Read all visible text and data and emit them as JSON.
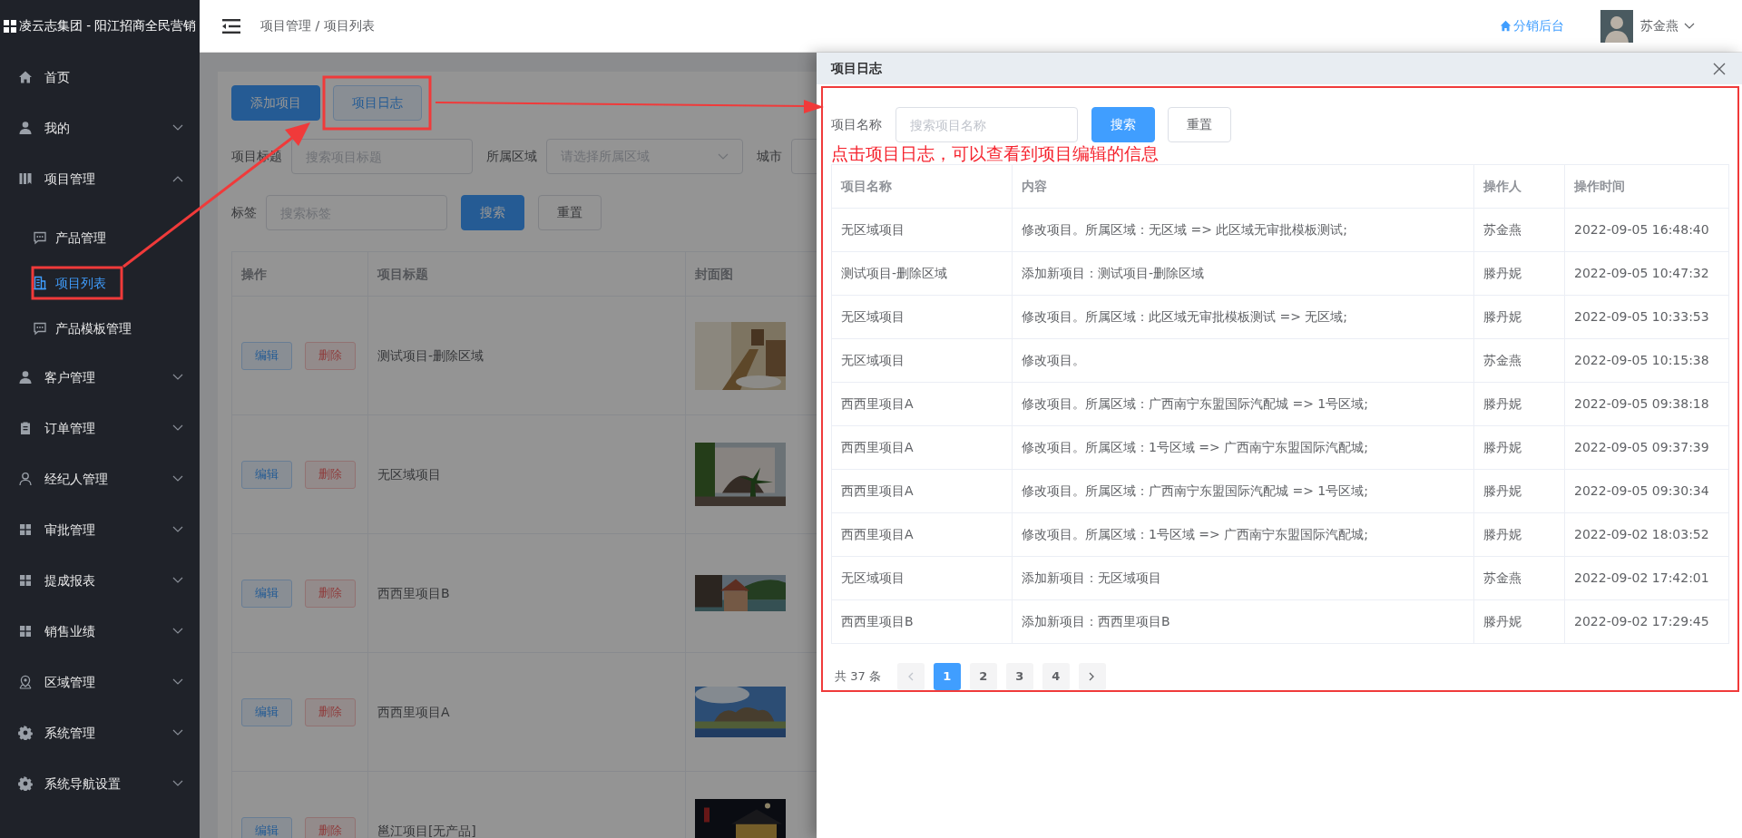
{
  "sidebar": {
    "title": "凌云志集团 - 阳江招商全民营销",
    "items": [
      {
        "label": "首页",
        "selected": false
      },
      {
        "label": "我的",
        "selected": false,
        "expanded": false
      },
      {
        "label": "项目管理",
        "selected": false,
        "expanded": true,
        "children": [
          {
            "label": "产品管理",
            "selected": false
          },
          {
            "label": "项目列表",
            "selected": true
          },
          {
            "label": "产品模板管理",
            "selected": false
          }
        ]
      },
      {
        "label": "客户管理",
        "selected": false,
        "expanded": false
      },
      {
        "label": "订单管理",
        "selected": false,
        "expanded": false
      },
      {
        "label": "经纪人管理",
        "selected": false,
        "expanded": false
      },
      {
        "label": "审批管理",
        "selected": false,
        "expanded": false
      },
      {
        "label": "提成报表",
        "selected": false,
        "expanded": false
      },
      {
        "label": "销售业绩",
        "selected": false,
        "expanded": false
      },
      {
        "label": "区域管理",
        "selected": false,
        "expanded": false
      },
      {
        "label": "系统管理",
        "selected": false,
        "expanded": false
      },
      {
        "label": "系统导航设置",
        "selected": false,
        "expanded": false
      }
    ]
  },
  "topbar": {
    "breadcrumb": "项目管理 / 项目列表",
    "link": "分销后台",
    "user": "苏金燕"
  },
  "main": {
    "buttons": [
      {
        "label": "添加项目",
        "kind": "primary"
      },
      {
        "label": "项目日志",
        "kind": "plain"
      }
    ],
    "filters": [
      [
        {
          "label": "项目标题",
          "kind": "input",
          "placeholder": "搜索项目标题"
        },
        {
          "label": "所属区域",
          "kind": "select",
          "placeholder": "请选择所属区域"
        },
        {
          "label": "城市",
          "kind": "input"
        }
      ],
      [
        {
          "label": "标签",
          "kind": "input",
          "placeholder": "搜索标签"
        }
      ]
    ],
    "search_buttons": [
      "搜索",
      "重置"
    ],
    "table": {
      "columns": [
        "操作",
        "项目标题",
        "封面图"
      ],
      "rows": [
        {
          "actions": [
            "编辑",
            "删除"
          ],
          "title": "测试项目-删除区域",
          "cover": {
            "kind": "picture"
          }
        },
        {
          "actions": [
            "编辑",
            "删除"
          ],
          "title": "无区域项目",
          "cover": {
            "kind": "picture"
          }
        },
        {
          "actions": [
            "编辑",
            "删除"
          ],
          "title": "西西里项目B",
          "cover": {
            "kind": "picture"
          }
        },
        {
          "actions": [
            "编辑",
            "删除"
          ],
          "title": "西西里项目A",
          "cover": {
            "kind": "picture"
          }
        },
        {
          "actions": [
            "编辑",
            "删除"
          ],
          "title": "邕江项目[无产品]",
          "cover": {
            "kind": "picture"
          }
        }
      ]
    }
  },
  "drawer": {
    "title": "项目日志",
    "filter": {
      "label": "项目名称",
      "placeholder": "搜索项目名称"
    },
    "buttons": [
      "搜索",
      "重置"
    ],
    "annotation": "点击项目日志，可以查看到项目编辑的信息",
    "table": {
      "columns": [
        "项目名称",
        "内容",
        "操作人",
        "操作时间"
      ],
      "rows": [
        [
          "无区域项目",
          "修改项目。所属区域：无区域 => 此区域无审批模板测试;",
          "苏金燕",
          "2022-09-05 16:48:40"
        ],
        [
          "测试项目-删除区域",
          "添加新项目：测试项目-删除区域",
          "滕丹妮",
          "2022-09-05 10:47:32"
        ],
        [
          "无区域项目",
          "修改项目。所属区域：此区域无审批模板测试 => 无区域;",
          "滕丹妮",
          "2022-09-05 10:33:53"
        ],
        [
          "无区域项目",
          "修改项目。",
          "苏金燕",
          "2022-09-05 10:15:38"
        ],
        [
          "西西里项目A",
          "修改项目。所属区域：广西南宁东盟国际汽配城 => 1号区域;",
          "滕丹妮",
          "2022-09-05 09:38:18"
        ],
        [
          "西西里项目A",
          "修改项目。所属区域：1号区域 => 广西南宁东盟国际汽配城;",
          "滕丹妮",
          "2022-09-05 09:37:39"
        ],
        [
          "西西里项目A",
          "修改项目。所属区域：广西南宁东盟国际汽配城 => 1号区域;",
          "滕丹妮",
          "2022-09-05 09:30:34"
        ],
        [
          "西西里项目A",
          "修改项目。所属区域：1号区域 => 广西南宁东盟国际汽配城;",
          "滕丹妮",
          "2022-09-02 18:03:52"
        ],
        [
          "无区域项目",
          "添加新项目：无区域项目",
          "苏金燕",
          "2022-09-02 17:42:01"
        ],
        [
          "西西里项目B",
          "添加新项目：西西里项目B",
          "滕丹妮",
          "2022-09-02 17:29:45"
        ]
      ]
    },
    "pagination": {
      "total": "共 37 条",
      "pages": [
        {
          "label": "1",
          "selected": true
        },
        {
          "label": "2",
          "selected": false
        },
        {
          "label": "3",
          "selected": false
        },
        {
          "label": "4",
          "selected": false
        }
      ]
    }
  }
}
